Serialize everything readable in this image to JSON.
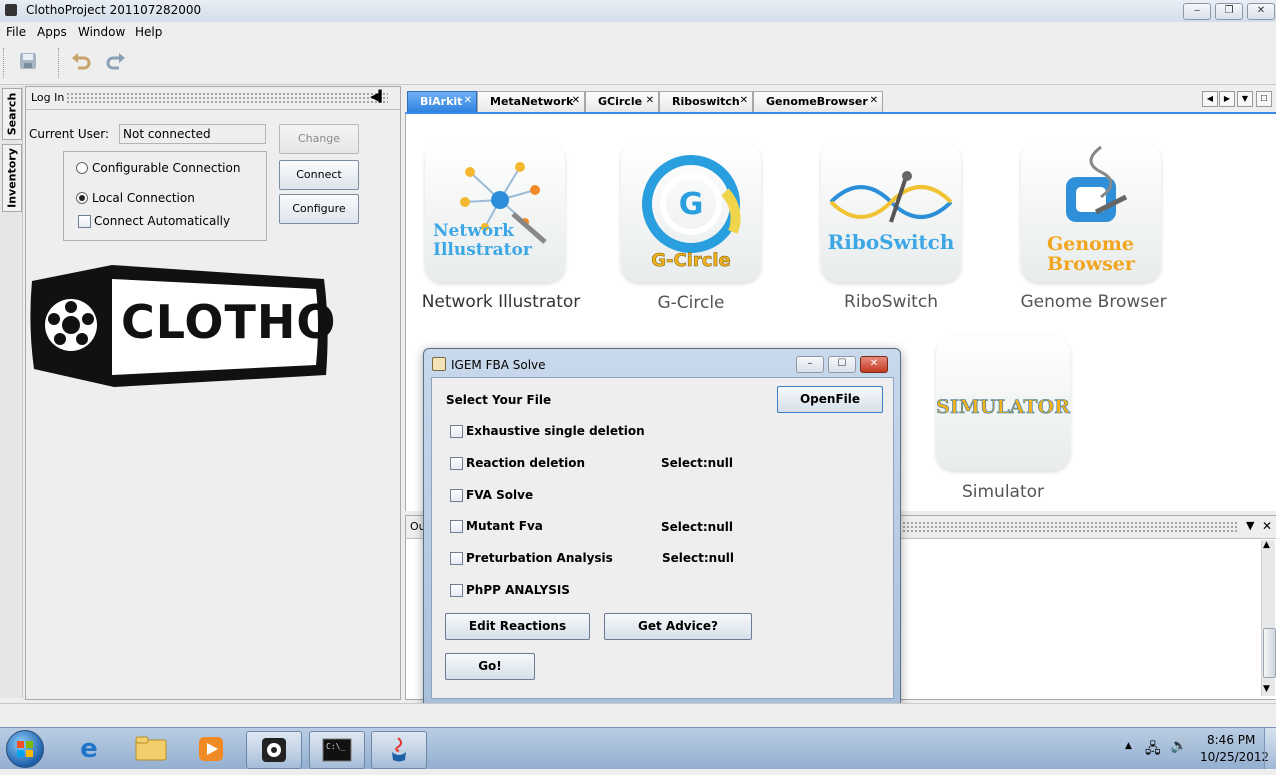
{
  "window": {
    "title": "ClothoProject 201107282000",
    "min_label": "‒",
    "max_label": "❐",
    "close_label": "✕"
  },
  "menu": [
    {
      "label": "File"
    },
    {
      "label": "Apps"
    },
    {
      "label": "Window"
    },
    {
      "label": "Help"
    }
  ],
  "toolbar": {
    "save_icon": "save-icon",
    "undo_icon": "undo-icon",
    "redo_icon": "redo-icon"
  },
  "side_tabs": [
    {
      "label": "Search"
    },
    {
      "label": "Inventory"
    }
  ],
  "login": {
    "header": "Log In",
    "current_user_label": "Current User:",
    "current_user_value": "Not connected",
    "change_label": "Change",
    "connect_label": "Connect",
    "configure_label": "Configure",
    "configurable_connection": "Configurable Connection",
    "local_connection": "Local Connection",
    "connect_automatically": "Connect Automatically",
    "selected_connection": "Local Connection",
    "auto_connect_checked": false
  },
  "logo": {
    "text": "CLOTHO"
  },
  "tabs": [
    {
      "label": "BiArkit",
      "active": true
    },
    {
      "label": "MetaNetwork",
      "active": false
    },
    {
      "label": "GCircle",
      "active": false
    },
    {
      "label": "Riboswitch",
      "active": false
    },
    {
      "label": "GenomeBrowser",
      "active": false
    }
  ],
  "apps": [
    {
      "name": "Network Illustrator",
      "tile_text": "Network Illustrator"
    },
    {
      "name": "G-Circle",
      "tile_text": "G-Circle"
    },
    {
      "name": "RiboSwitch",
      "tile_text": "RiboSwitch"
    },
    {
      "name": "Genome Browser",
      "tile_text": "Genome Browser"
    },
    {
      "name": "Simulator",
      "tile_text": "SIMULATOR"
    }
  ],
  "output": {
    "header": "Ou"
  },
  "dialog": {
    "title": "IGEM FBA Solve",
    "select_file_label": "Select Your File",
    "open_file_label": "OpenFile",
    "options": [
      {
        "label": "Exhaustive single deletion",
        "select": ""
      },
      {
        "label": "Reaction deletion",
        "select": "Select:null"
      },
      {
        "label": "FVA Solve",
        "select": ""
      },
      {
        "label": "Mutant Fva",
        "select": "Select:null"
      },
      {
        "label": "Preturbation Analysis",
        "select": "Select:null"
      },
      {
        "label": "PhPP ANALYSIS",
        "select": ""
      }
    ],
    "edit_reactions_label": "Edit Reactions",
    "get_advice_label": "Get Advice?",
    "go_label": "Go!"
  },
  "taskbar": {
    "clock_time": "8:46 PM",
    "clock_date": "10/25/2012",
    "items": [
      "start-icon",
      "internet-explorer-icon",
      "file-explorer-icon",
      "media-player-icon",
      "clotho-icon",
      "command-prompt-icon",
      "java-icon"
    ]
  },
  "colors": {
    "accent": "#3c8bea",
    "tab_active": "#2f82e0",
    "taskbar": "#a9c0dc"
  }
}
